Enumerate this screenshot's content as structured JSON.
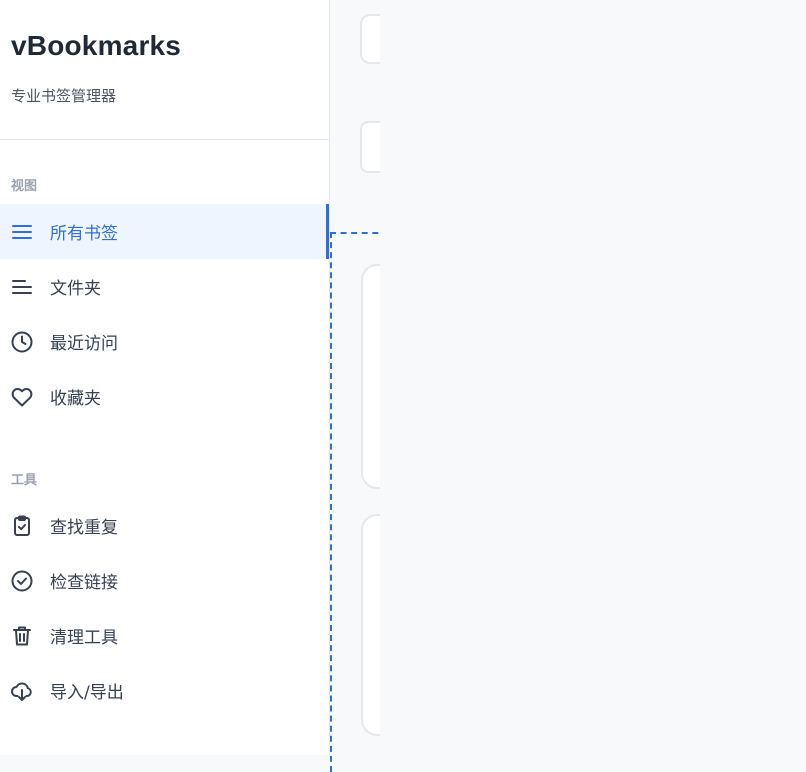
{
  "app": {
    "title": "vBookmarks",
    "subtitle": "专业书签管理器"
  },
  "sidebar": {
    "sections": [
      {
        "label": "视图",
        "items": [
          {
            "label": "所有书签",
            "icon": "menu-lines-icon",
            "active": true
          },
          {
            "label": "文件夹",
            "icon": "folder-lines-icon",
            "active": false
          },
          {
            "label": "最近访问",
            "icon": "clock-icon",
            "active": false
          },
          {
            "label": "收藏夹",
            "icon": "heart-icon",
            "active": false
          }
        ]
      },
      {
        "label": "工具",
        "items": [
          {
            "label": "查找重复",
            "icon": "clipboard-check-icon",
            "active": false
          },
          {
            "label": "检查链接",
            "icon": "check-circle-icon",
            "active": false
          },
          {
            "label": "清理工具",
            "icon": "trash-icon",
            "active": false
          },
          {
            "label": "导入/导出",
            "icon": "cloud-download-icon",
            "active": false
          }
        ]
      }
    ]
  },
  "colors": {
    "accent": "#2f6fd6",
    "active_bg": "#eef5ff",
    "text": "#374151",
    "muted": "#9ca3af"
  }
}
